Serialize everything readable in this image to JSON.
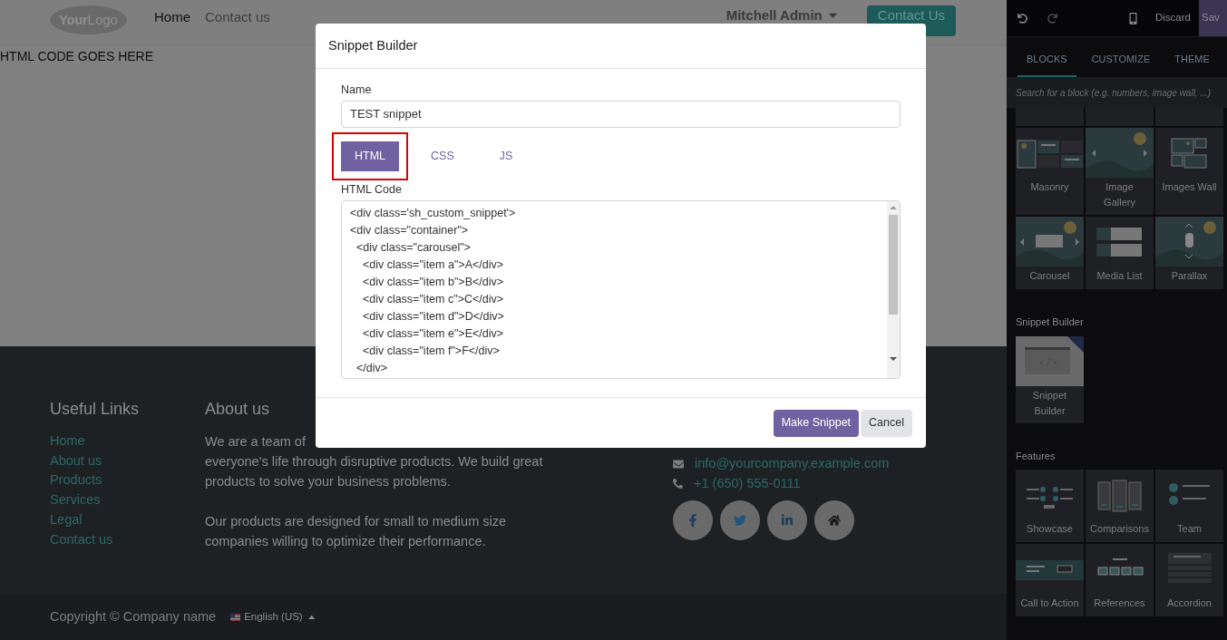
{
  "header": {
    "logo": {
      "bold": "Your",
      "light": "Logo"
    },
    "nav": [
      {
        "label": "Home",
        "selected": true
      },
      {
        "label": "Contact us",
        "selected": false
      }
    ],
    "user": "Mitchell Admin",
    "cta": "Contact Us"
  },
  "content": {
    "text": "HTML CODE GOES HERE"
  },
  "footer": {
    "links_title": "Useful Links",
    "links": [
      "Home",
      "About us",
      "Products",
      "Services",
      "Legal",
      "Contact us"
    ],
    "about_title": "About us",
    "about_lines": [
      "We are a team of",
      "everyone's life through disruptive products. We build great",
      "products to solve your business problems."
    ],
    "about_lines_2": [
      "Our products are designed for small to medium size",
      "companies willing to optimize their performance."
    ],
    "email": "info@yourcompany.example.com",
    "phone": "+1 (650) 555-0111",
    "social": [
      {
        "kind": "facebook"
      },
      {
        "kind": "twitter"
      },
      {
        "kind": "linkedin"
      },
      {
        "kind": "home"
      }
    ],
    "copyright": "Copyright © Company name",
    "language": "English (US)"
  },
  "modal": {
    "title": "Snippet Builder",
    "name_label": "Name",
    "name_value": "TEST snippet",
    "tabs": [
      {
        "label": "HTML",
        "selected": true,
        "highlighted": true
      },
      {
        "label": "CSS",
        "selected": false,
        "highlighted": false
      },
      {
        "label": "JS",
        "selected": false,
        "highlighted": false
      }
    ],
    "code_label": "HTML Code",
    "code_lines": [
      "<div class='sh_custom_snippet'>",
      "<div class=\"container\">",
      "  <div class=\"carousel\">",
      "    <div class=\"item a\">A</div>",
      "    <div class=\"item b\">B</div>",
      "    <div class=\"item c\">C</div>",
      "    <div class=\"item d\">D</div>",
      "    <div class=\"item e\">E</div>",
      "    <div class=\"item f\">F</div>",
      "  </div>"
    ],
    "buttons": [
      {
        "label": "Make Snippet",
        "kind": "primary"
      },
      {
        "label": "Cancel",
        "kind": "secondary"
      }
    ]
  },
  "sidebar": {
    "discard": "Discard",
    "save": "Sav",
    "tabs": [
      {
        "label": "BLOCKS",
        "selected": true
      },
      {
        "label": "CUSTOMIZE",
        "selected": false
      },
      {
        "label": "THEME",
        "selected": false
      }
    ],
    "search_placeholder": "Search for a block (e.g. numbers, image wall, ...)",
    "blocks": [
      {
        "label": "Masonry",
        "kind": "masonry"
      },
      {
        "label": "Image Gallery",
        "kind": "gallery"
      },
      {
        "label": "Images Wall",
        "kind": "wall"
      },
      {
        "label": "Carousel",
        "kind": "carousel"
      },
      {
        "label": "Media List",
        "kind": "media"
      },
      {
        "label": "Parallax",
        "kind": "parallax"
      }
    ],
    "sections": [
      {
        "title": "Snippet Builder",
        "blocks": [
          {
            "label": "Snippet Builder",
            "kind": "snippet"
          }
        ]
      },
      {
        "title": "Features",
        "blocks": [
          {
            "label": "Showcase",
            "kind": "showcase"
          },
          {
            "label": "Comparisons",
            "kind": "comparisons"
          },
          {
            "label": "Team",
            "kind": "team"
          },
          {
            "label": "Call to Action",
            "kind": "cta"
          },
          {
            "label": "References",
            "kind": "references"
          },
          {
            "label": "Accordion",
            "kind": "accordion"
          }
        ]
      }
    ]
  }
}
